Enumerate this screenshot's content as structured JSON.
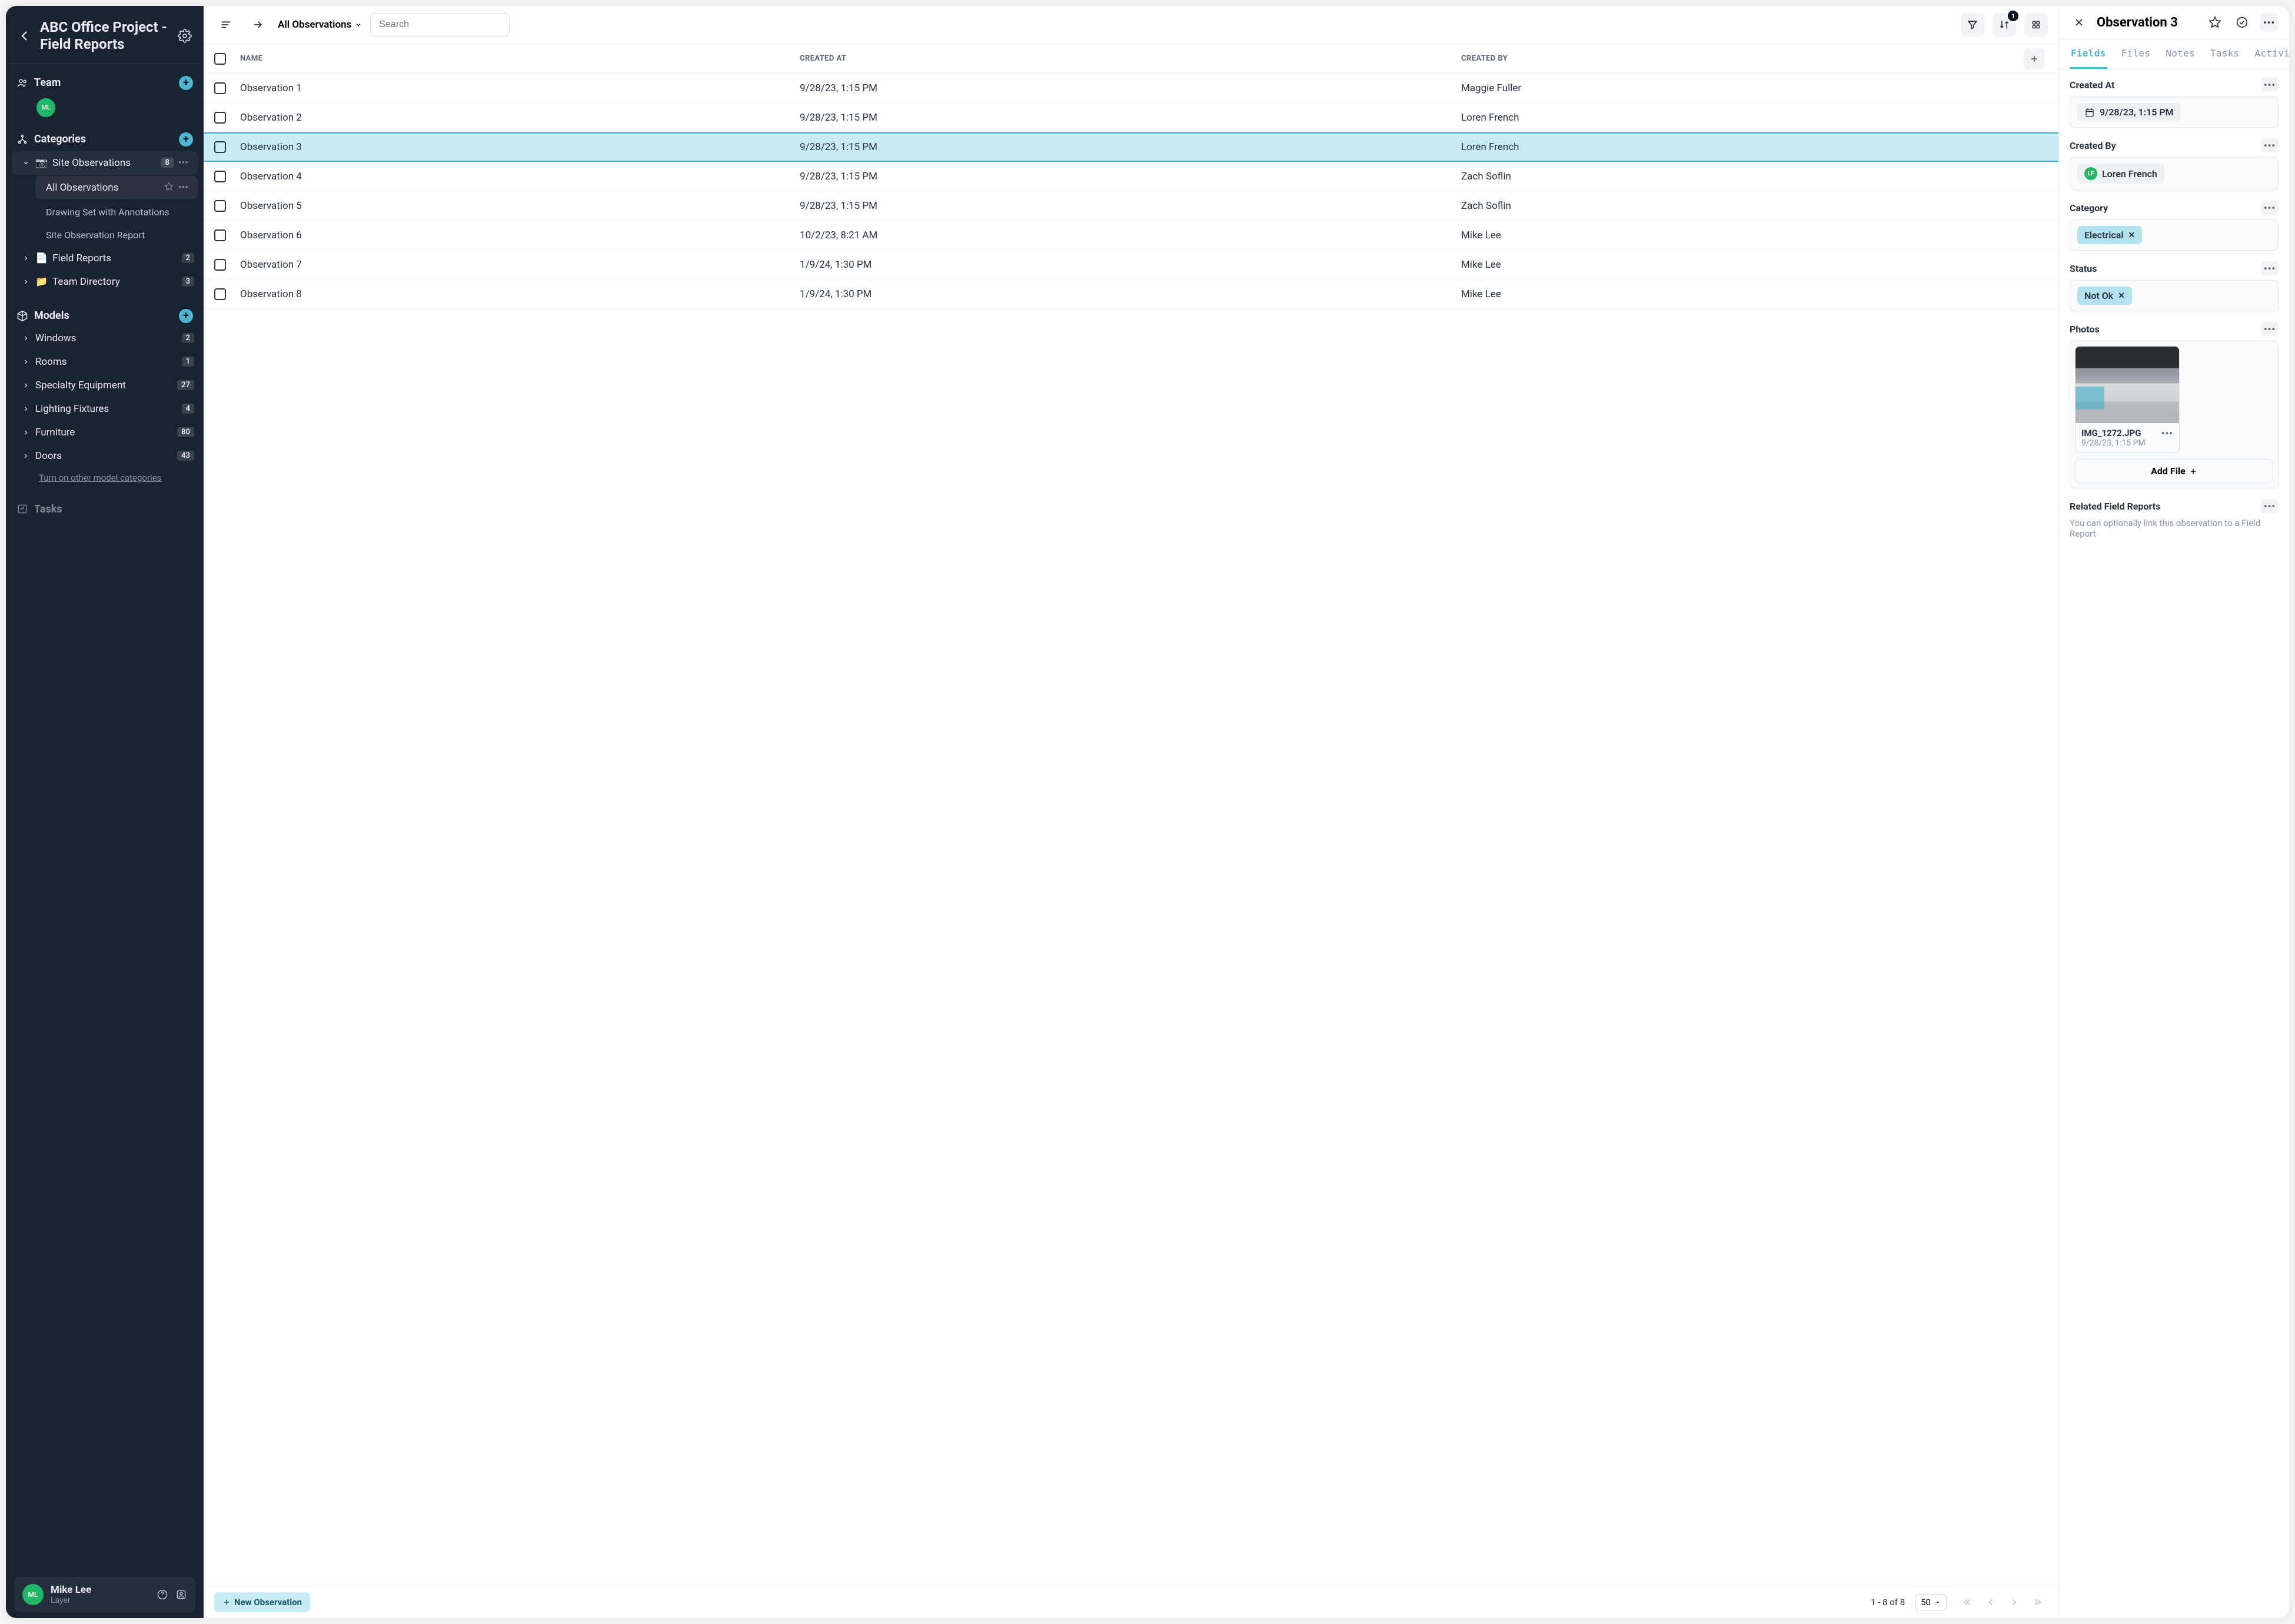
{
  "project_title": "ABC Office Project - Field Reports",
  "sidebar": {
    "team": {
      "title": "Team",
      "avatar_initials": "ML"
    },
    "categories": {
      "title": "Categories",
      "items": [
        {
          "label": "Site Observations",
          "icon": "📷",
          "count": "8",
          "expanded": true,
          "children": [
            {
              "label": "All Observations",
              "active": true
            },
            {
              "label": "Drawing Set with Annotations"
            },
            {
              "label": "Site Observation Report"
            }
          ]
        },
        {
          "label": "Field Reports",
          "icon": "📄",
          "count": "2"
        },
        {
          "label": "Team Directory",
          "icon": "📁",
          "count": "3"
        }
      ]
    },
    "models": {
      "title": "Models",
      "items": [
        {
          "label": "Windows",
          "count": "2"
        },
        {
          "label": "Rooms",
          "count": "1"
        },
        {
          "label": "Specialty Equipment",
          "count": "27"
        },
        {
          "label": "Lighting Fixtures",
          "count": "4"
        },
        {
          "label": "Furniture",
          "count": "80"
        },
        {
          "label": "Doors",
          "count": "43"
        }
      ],
      "turn_on_link": "Turn on other model categories"
    },
    "tasks_label": "Tasks"
  },
  "user_footer": {
    "initials": "ML",
    "name": "Mike Lee",
    "sub": "Layer"
  },
  "toolbar": {
    "breadcrumb": "All Observations",
    "search_placeholder": "Search",
    "sort_badge": "1"
  },
  "table": {
    "headers": {
      "name": "NAME",
      "created_at": "CREATED AT",
      "created_by": "CREATED BY"
    },
    "rows": [
      {
        "name": "Observation 1",
        "created_at": "9/28/23, 1:15 PM",
        "created_by": "Maggie Fuller"
      },
      {
        "name": "Observation 2",
        "created_at": "9/28/23, 1:15 PM",
        "created_by": "Loren French"
      },
      {
        "name": "Observation 3",
        "created_at": "9/28/23, 1:15 PM",
        "created_by": "Loren French",
        "selected": true
      },
      {
        "name": "Observation 4",
        "created_at": "9/28/23, 1:15 PM",
        "created_by": "Zach Soflin"
      },
      {
        "name": "Observation 5",
        "created_at": "9/28/23, 1:15 PM",
        "created_by": "Zach Soflin"
      },
      {
        "name": "Observation 6",
        "created_at": "10/2/23, 8:21 AM",
        "created_by": "Mike Lee"
      },
      {
        "name": "Observation 7",
        "created_at": "1/9/24, 1:30 PM",
        "created_by": "Mike Lee"
      },
      {
        "name": "Observation 8",
        "created_at": "1/9/24, 1:30 PM",
        "created_by": "Mike Lee"
      }
    ]
  },
  "bottom_bar": {
    "new_label": "New Observation",
    "pager_text": "1 - 8 of 8",
    "page_size": "50"
  },
  "detail": {
    "title": "Observation 3",
    "tabs": [
      "Fields",
      "Files",
      "Notes",
      "Tasks",
      "Activity"
    ],
    "active_tab": "Fields",
    "created_at": {
      "label": "Created At",
      "value": "9/28/23, 1:15 PM"
    },
    "created_by": {
      "label": "Created By",
      "value": "Loren French",
      "initials": "LF"
    },
    "category": {
      "label": "Category",
      "value": "Electrical"
    },
    "status": {
      "label": "Status",
      "value": "Not Ok"
    },
    "photos": {
      "label": "Photos",
      "file_name": "IMG_1272.JPG",
      "file_date": "9/28/23, 1:15 PM",
      "add_label": "Add File"
    },
    "related": {
      "label": "Related Field Reports",
      "hint": "You can optionally link this observation to a Field Report"
    }
  }
}
